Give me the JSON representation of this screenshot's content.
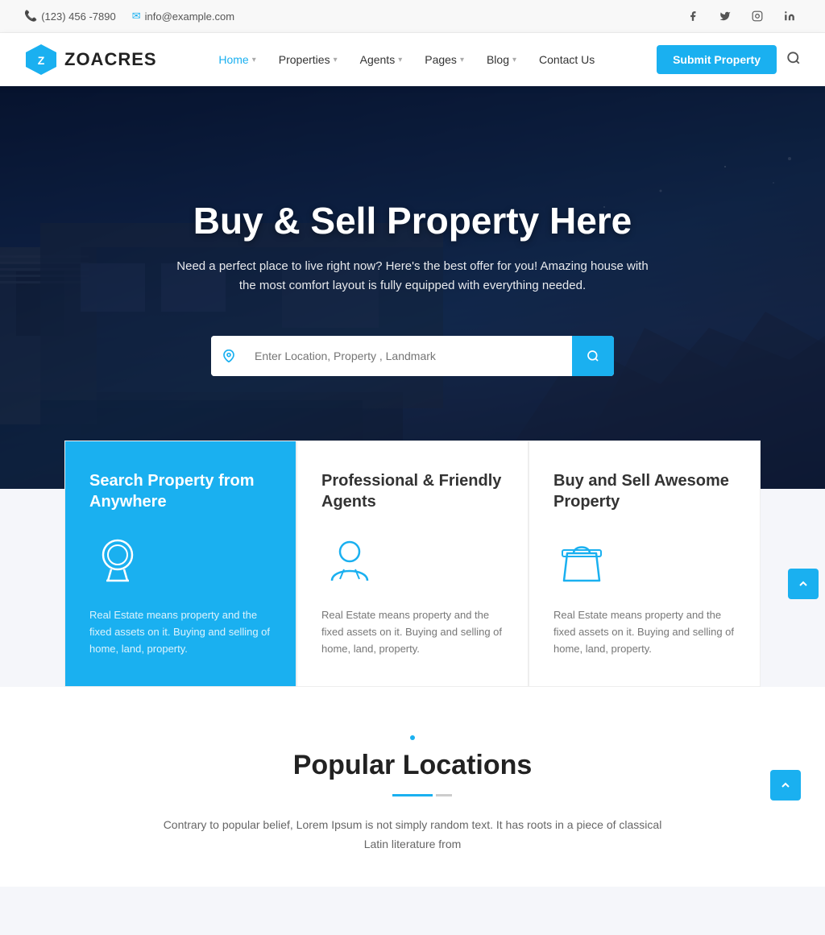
{
  "topbar": {
    "phone": "(123) 456 -7890",
    "email": "info@example.com"
  },
  "social": {
    "facebook": "f",
    "twitter": "t",
    "instagram": "i",
    "linkedin": "in"
  },
  "header": {
    "logo_text": "ZOACRES",
    "nav": [
      {
        "label": "Home",
        "active": true,
        "has_dropdown": true
      },
      {
        "label": "Properties",
        "has_dropdown": true
      },
      {
        "label": "Agents",
        "has_dropdown": true
      },
      {
        "label": "Pages",
        "has_dropdown": true
      },
      {
        "label": "Blog",
        "has_dropdown": true
      },
      {
        "label": "Contact Us",
        "has_dropdown": false
      }
    ],
    "submit_btn": "Submit Property"
  },
  "hero": {
    "title": "Buy & Sell Property Here",
    "subtitle": "Need a perfect place to live right now? Here's the best offer for you! Amazing house with the most comfort layout is fully equipped with everything needed.",
    "search_placeholder": "Enter Location, Property , Landmark"
  },
  "features": [
    {
      "title": "Search Property from Anywhere",
      "desc": "Real Estate means property and the fixed assets on it. Buying and selling of home, land, property.",
      "icon": "award"
    },
    {
      "title": "Professional & Friendly Agents",
      "desc": "Real Estate means property and the fixed assets on it. Buying and selling of home, land, property.",
      "icon": "person"
    },
    {
      "title": "Buy and Sell Awesome Property",
      "desc": "Real Estate means property and the fixed assets on it. Buying and selling of home, land, property.",
      "icon": "bag"
    }
  ],
  "popular_locations": {
    "title": "Popular Locations",
    "desc": "Contrary to popular belief, Lorem Ipsum is not simply random text. It has roots in a piece of classical Latin literature from"
  }
}
